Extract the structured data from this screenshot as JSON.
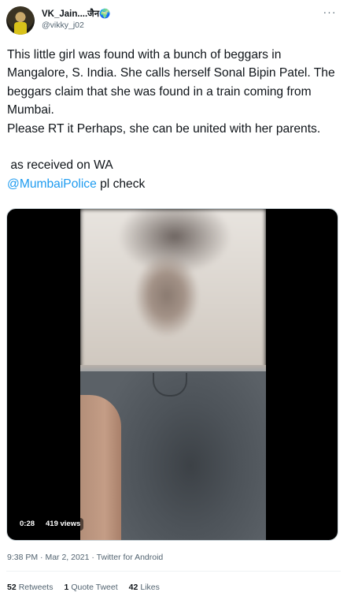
{
  "author": {
    "display_name": "VK_Jain....जैन🌍",
    "handle": "@vikky_j02"
  },
  "more_label": "···",
  "tweet": {
    "line1": "This little girl was found with a bunch of beggars in Mangalore, S. India. She calls herself Sonal Bipin Patel. The beggars claim that she was found in a train coming from Mumbai.\nPlease RT it Perhaps, she can be united with her parents.\n\n as received on WA\n",
    "mention": "@MumbaiPolice",
    "mention_suffix": " pl check"
  },
  "media": {
    "duration": "0:28",
    "views": "419 views"
  },
  "meta": {
    "time": "9:38 PM",
    "sep1": " · ",
    "date": "Mar 2, 2021",
    "sep2": " · ",
    "source": "Twitter for Android"
  },
  "stats": {
    "retweets_count": "52",
    "retweets_label": "Retweets",
    "quotes_count": "1",
    "quotes_label": "Quote Tweet",
    "likes_count": "42",
    "likes_label": "Likes"
  }
}
